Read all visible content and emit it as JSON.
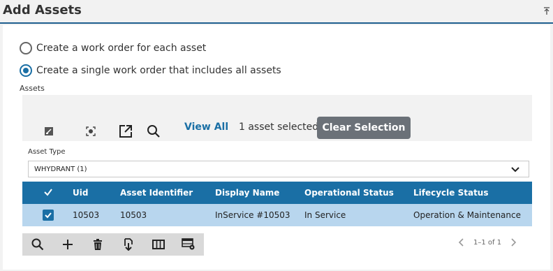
{
  "header": {
    "title": "Add Assets"
  },
  "options": {
    "per_asset": "Create a work order for each asset",
    "single": "Create a single work order that includes all assets"
  },
  "assets": {
    "label": "Assets",
    "view_all": "View All",
    "selected_text": "1 asset selected",
    "clear_selection": "Clear Selection",
    "asset_type_label": "Asset Type",
    "asset_type_value": "WHYDRANT (1)"
  },
  "table": {
    "columns": [
      "Uid",
      "Asset Identifier",
      "Display Name",
      "Operational Status",
      "Lifecycle Status"
    ],
    "rows": [
      {
        "uid": "10503",
        "asset_identifier": "10503",
        "display_name": "InService #10503",
        "operational_status": "In Service",
        "lifecycle_status": "Operation & Maintenance"
      }
    ]
  },
  "pager": {
    "text": "1–1 of 1"
  },
  "colors": {
    "accent": "#1a6fa5",
    "header_row": "#1a6fa5",
    "selected_row": "#b8d6ee",
    "clear_button": "#6b7178"
  },
  "icons": [
    "collapse-icon",
    "map-edit-icon",
    "locate-icon",
    "open-external-icon",
    "search-icon",
    "chevron-down-icon",
    "check-icon",
    "add-icon",
    "delete-icon",
    "download-icon",
    "columns-icon",
    "table-settings-icon",
    "chevron-left-icon",
    "chevron-right-icon"
  ]
}
